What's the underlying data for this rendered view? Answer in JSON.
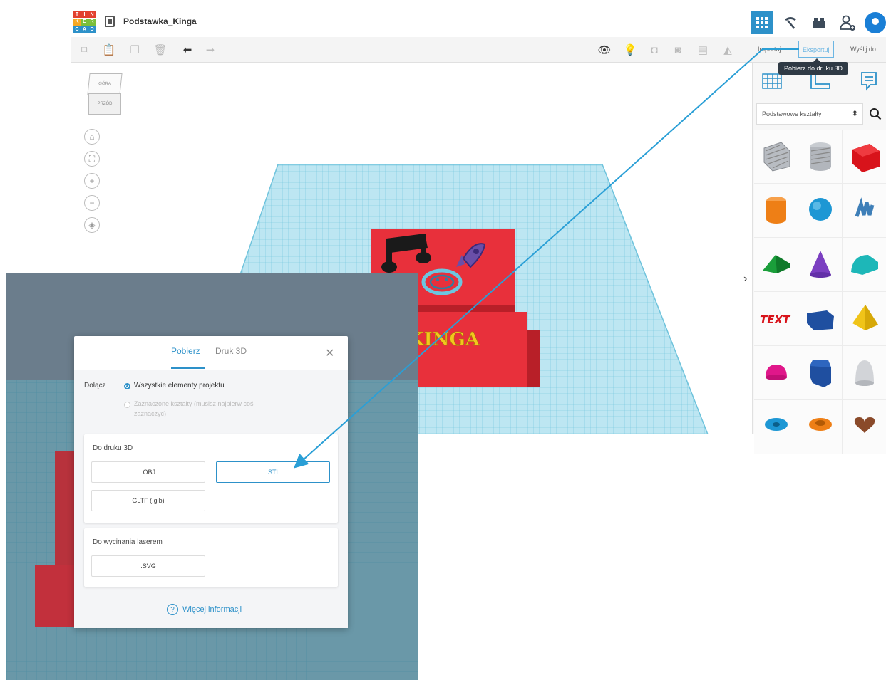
{
  "app": {
    "logo_letters": [
      "T",
      "I",
      "N",
      "K",
      "E",
      "R",
      "C",
      "A",
      "D"
    ],
    "project_title": "Podstawka_Kinga"
  },
  "header": {
    "icons": [
      "grid-view-icon",
      "pickaxe-icon",
      "bricks-icon",
      "add-user-icon",
      "avatar-icon"
    ]
  },
  "toolbar": {
    "import_label": "Importuj",
    "export_label": "Eksportuj",
    "send_label": "Wyślij do",
    "tooltip": "Pobierz do druku 3D"
  },
  "viewcube": {
    "top_label": "GÓRA",
    "front_label": "PRZÓD"
  },
  "right_panel": {
    "category_selected": "Podstawowe kształty"
  },
  "model": {
    "name_text": "KINGA"
  },
  "dialog": {
    "tab_download": "Pobierz",
    "tab_print": "Druk 3D",
    "include_label": "Dołącz",
    "option_all": "Wszystkie elementy projektu",
    "option_selected": "Zaznaczone kształty (musisz najpierw coś zaznaczyć)",
    "print_section_title": "Do druku 3D",
    "btn_obj": ".OBJ",
    "btn_stl": ".STL",
    "btn_gltf": "GLTF (.glb)",
    "laser_section_title": "Do wycinania laserem",
    "btn_svg": ".SVG",
    "more_info": "Więcej informacji"
  },
  "colors": {
    "accent": "#2d91c9",
    "grid": "#8fd3e8",
    "model_red": "#e8303b",
    "model_text": "#f2c71e"
  }
}
